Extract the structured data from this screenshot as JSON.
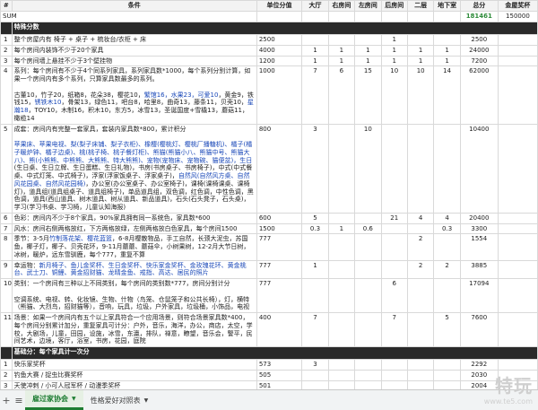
{
  "header": {
    "hash": "#",
    "condition": "条件",
    "unit_score": "单位分值",
    "hall": "大厅",
    "right_room": "右房间",
    "left_room": "左房间",
    "back_room": "后房间",
    "floor2": "二层",
    "basement": "地下室",
    "total": "总分",
    "gold_prize": "金屋奖杯"
  },
  "sum_row": {
    "label": "SUM",
    "total": "181461",
    "gold": "150000"
  },
  "section1": {
    "title": "特殊分数"
  },
  "rows": [
    {
      "idx": "1",
      "cond": "整个房屋内有 椅子 + 桌子 + 梳妆台/衣柜 + 床",
      "score": "2500",
      "c1": "",
      "c2": "",
      "c3": "",
      "c4": "1",
      "c5": "",
      "c6": "",
      "total": "2500"
    },
    {
      "idx": "2",
      "cond": "每个房间内装饰不少于20个家具",
      "score": "4000",
      "c1": "1",
      "c2": "1",
      "c3": "1",
      "c4": "1",
      "c5": "1",
      "c6": "1",
      "total": "24000"
    },
    {
      "idx": "3",
      "cond": "每个房间墙上悬挂不少于3个壁挂物",
      "score": "1200",
      "c1": "1",
      "c2": "1",
      "c3": "1",
      "c4": "1",
      "c5": "1",
      "c6": "1",
      "total": "7200"
    },
    {
      "idx": "4",
      "score": "1000",
      "c1": "7",
      "c2": "6",
      "c3": "15",
      "c4": "10",
      "c5": "10",
      "c6": "14",
      "total": "62000"
    },
    {
      "idx": "5",
      "score": "800",
      "c1": "3",
      "c2": "",
      "c3": "10",
      "c4": "",
      "c5": "",
      "c6": "",
      "total": "10400"
    },
    {
      "idx": "6",
      "cond": "色彩：房间内不少于8个家具，90%家具拥有同一系统色，家具数*600",
      "score": "600",
      "c1": "5",
      "c2": "",
      "c3": "",
      "c4": "21",
      "c5": "4",
      "c6": "4",
      "total": "20400"
    },
    {
      "idx": "7",
      "cond": "风水：房间右侧两格放红，下方两格放绿，左侧两格放白色家具，每个房间1500",
      "score": "1500",
      "c1": "0.3",
      "c2": "1",
      "c3": "0.6",
      "c4": "",
      "c5": "",
      "c6": "0.3",
      "total": "3300"
    },
    {
      "idx": "8",
      "score": "777",
      "c1": "",
      "c2": "",
      "c3": "",
      "c4": "",
      "c5": "2",
      "c6": "",
      "total": "1554"
    },
    {
      "idx": "9",
      "score": "777",
      "c1": "1",
      "c2": "",
      "c3": "",
      "c4": "",
      "c5": "2",
      "c6": "2",
      "total": "3885"
    },
    {
      "idx": "10",
      "cond": "类别：一个房间有三种以上不同类别，每个房间的类别数*777，房间分别计分",
      "score": "777",
      "c1": "",
      "c2": "",
      "c3": "",
      "c4": "6",
      "c5": "",
      "c6": "",
      "total": "17094"
    },
    {
      "idx": "11",
      "cond": "场景：如果一个房间内有五个以上家具符合一个应用场景，则符合场景家具数*400，每个房间分别累计加分，重复家具可计分：户外，音乐，海洋，办公，商店，太空，学校，大剧场，儿童，田园，设施，冰雪，东瀛，排队，禅意，瞭望，音乐会，警平，民间艺术，边境，客厅，浴室，书房，花园，庭院",
      "score": "400",
      "c1": "7",
      "c2": "",
      "c3": "",
      "c4": "7",
      "c5": "",
      "c6": "5",
      "total": "7600"
    }
  ],
  "row4_text": {
    "intro": "系列：每个房间有不少于4个同系列家具，系列家具数*1000，每个系列分别计算，如果一个房间内有多个系列，只算家具数最多的系列。",
    "line1": "古董10，竹子20，纸箱8，花朵38，樱花10，",
    "hl1": "繁馆16，水果23，可爱10",
    "line1b": "，黄金9，铁钱15，",
    "hl2": "锈铁木10",
    "line2": "，骨架13，绿色11，吧台8，",
    "line3": "哈里8，曲奇13，藤条11，贝壳10，",
    "hl3": "星瀚18",
    "line3b": "，TOY10，木制16，积木10，东方5，冰雪13，圣诞国度+雪橇13，蘑菇11，橄榄14"
  },
  "row5_text": {
    "intro": "成套：房间内有完整一套家具，套装内家具数*800，累计积分",
    "green1": "苹果床、苹果电视、梨(梨子床铺、梨子衣柜)、橡樱(樱桃灯、樱桃厂播糖机)、橘子(橘子暖炉钟、橘子边桌)、桃(桃子椅、桃子餐灯柜)、熊猫(熊猫小八、熊猫中号、熊猫大八)、熊(小熊熊、中熊熊、大熊熊、特大熊熊)、宠物(宠物床、宠物碗、猫便盆)，生日",
    "plain1": "(生日桌、生日立牌、生日蛋糕、生日礼物)，书房(书房桌子、书房椅子)，中式(中式餐桌、中式灯笼、中式椅子)，浮家(浮家饭桌子、浮家桌子)，",
    "green2": "自然风(自然风方桌、自然风花园桌、自然风花园椅)",
    "plain2": "，办公室(办公室桌子、办公室椅子)，课椅(课椅课桌、课椅灯)，道具组(道具组桌子、道具组椅子)，单品道具组，双色调，红色调，中性色调，黑色调，道具(西山道具、树木道具、树从道具、新品道具)，石头(石头凳子，石头桌)，学习(学习书桌、学习椅，儿童认知海报)"
  },
  "row8_text": {
    "lead": "季节：3-5月",
    "hl": "竹制落花架、樱花蓝篮",
    "rest": "，6-8月樱散物品，手工自然，长颈大泥虫，苏国鱼，椰子灯，椰子、贝壳花环，9-11月蘑蘑、蘑菇伞，小树果树，12-2月大节日树，冰树，暖炉，远东雪驯鹿，每个777，重复不算"
  },
  "row9_text": {
    "lead": "幸运物：",
    "hl": "新月椅子、鱼儿金奖杯、生日金奖杯、快乐家金奖杯、金玫瑰花环、黄金桃台、武士刀、铜鲤、黄金招财猫、龙晴金鱼、",
    "rest": "戒指、高达、居民的照片"
  },
  "row10_extra": "空调系统、电视、转、化妆镜、生物、什物（鸟笼、仓鼠笼子和公共长椅），灯，横特（熊猫、大烈鸟，招财猫等），音响，玩具，垃圾，户外家具，垃圾桶，小饰品，电视",
  "section2": {
    "title": "基础分：每个家具计一次分"
  },
  "base_rows": [
    {
      "idx": "1",
      "cond": "快乐家奖杯",
      "score": "573",
      "c1": "3",
      "total": "2292"
    },
    {
      "idx": "2",
      "cond": "钓鱼大赛 / 捉虫比赛奖杯",
      "score": "505",
      "c1": "",
      "total": "2030"
    },
    {
      "idx": "3",
      "cond": "天使冲刺 / 小可人冠军杯 / 动漫季奖杯",
      "score": "501",
      "c1": "",
      "total": "2004"
    }
  ],
  "sheet_tabs": {
    "active": "雇过家协会",
    "other": "性格爱好对照表"
  },
  "watermark": {
    "name": "特玩",
    "site": "www.te5.com"
  }
}
